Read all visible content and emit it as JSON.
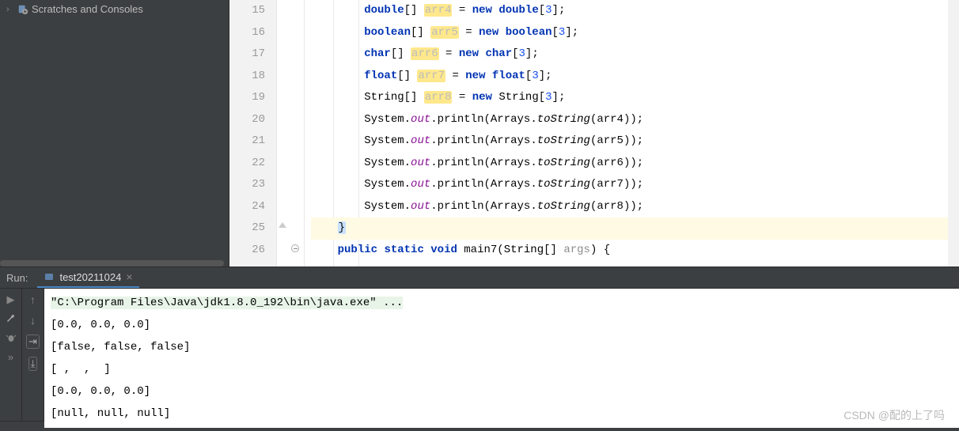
{
  "project_tree": {
    "scratches_label": "Scratches and Consoles"
  },
  "editor": {
    "lines": [
      {
        "n": 15
      },
      {
        "n": 16
      },
      {
        "n": 17
      },
      {
        "n": 18
      },
      {
        "n": 19
      },
      {
        "n": 20
      },
      {
        "n": 21
      },
      {
        "n": 22
      },
      {
        "n": 23
      },
      {
        "n": 24
      },
      {
        "n": 25
      },
      {
        "n": 26
      }
    ],
    "tokens": {
      "double": "double",
      "boolean": "boolean",
      "char": "char",
      "float": "float",
      "String": "String",
      "new": "new",
      "public": "public",
      "static": "static",
      "void": "void",
      "arr4": "arr4",
      "arr5": "arr5",
      "arr6": "arr6",
      "arr7": "arr7",
      "arr8": "arr8",
      "three": "3",
      "System": "System",
      "out": "out",
      "println": "println",
      "Arrays": "Arrays",
      "toString": "toString",
      "main7": "main7",
      "args": "args",
      "brace_close": "}",
      "brace_open": "{",
      "lparen": "(",
      "rparen": ")",
      "lbr": "[",
      "rbr": "]",
      "semi": ";",
      "eq": " = ",
      "comma": ", "
    }
  },
  "run": {
    "label": "Run:",
    "tab_name": "test20211024",
    "output": {
      "cmd": "\"C:\\Program Files\\Java\\jdk1.8.0_192\\bin\\java.exe\" ...",
      "lines": [
        "[0.0, 0.0, 0.0]",
        "[false, false, false]",
        "[ ,  ,  ]",
        "[0.0, 0.0, 0.0]",
        "[null, null, null]"
      ]
    }
  },
  "watermark": "CSDN @配的上了吗"
}
